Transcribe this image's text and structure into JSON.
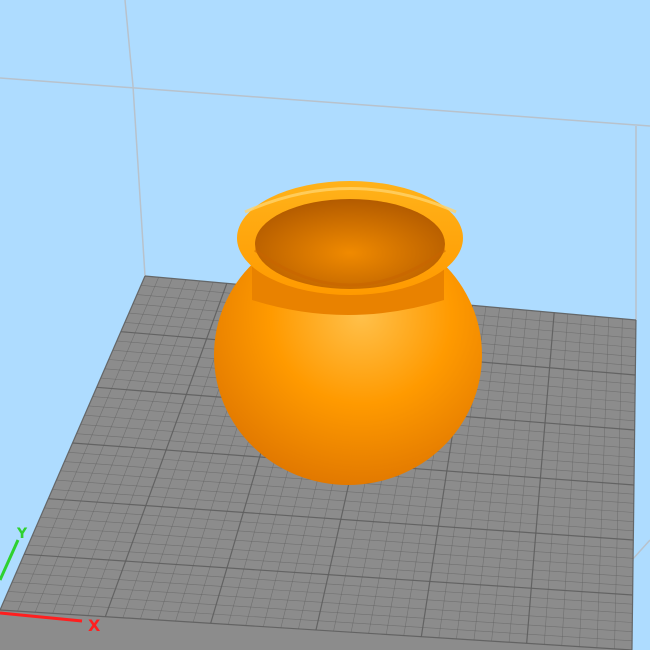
{
  "viewport": {
    "background_color": "#AEDCFF",
    "volume_line_color": "#B8C2CC",
    "plate_color": "#8C8C8C",
    "grid_line_color": "#5F5F5F",
    "model_color": "#FF9A00",
    "model_highlight_color": "#FFC04A",
    "model_shadow_color": "#D96F00",
    "axis_x_color": "#FF1F1F",
    "axis_y_color": "#2ED12E"
  },
  "axes": {
    "x_label": "X",
    "y_label": "Y"
  }
}
